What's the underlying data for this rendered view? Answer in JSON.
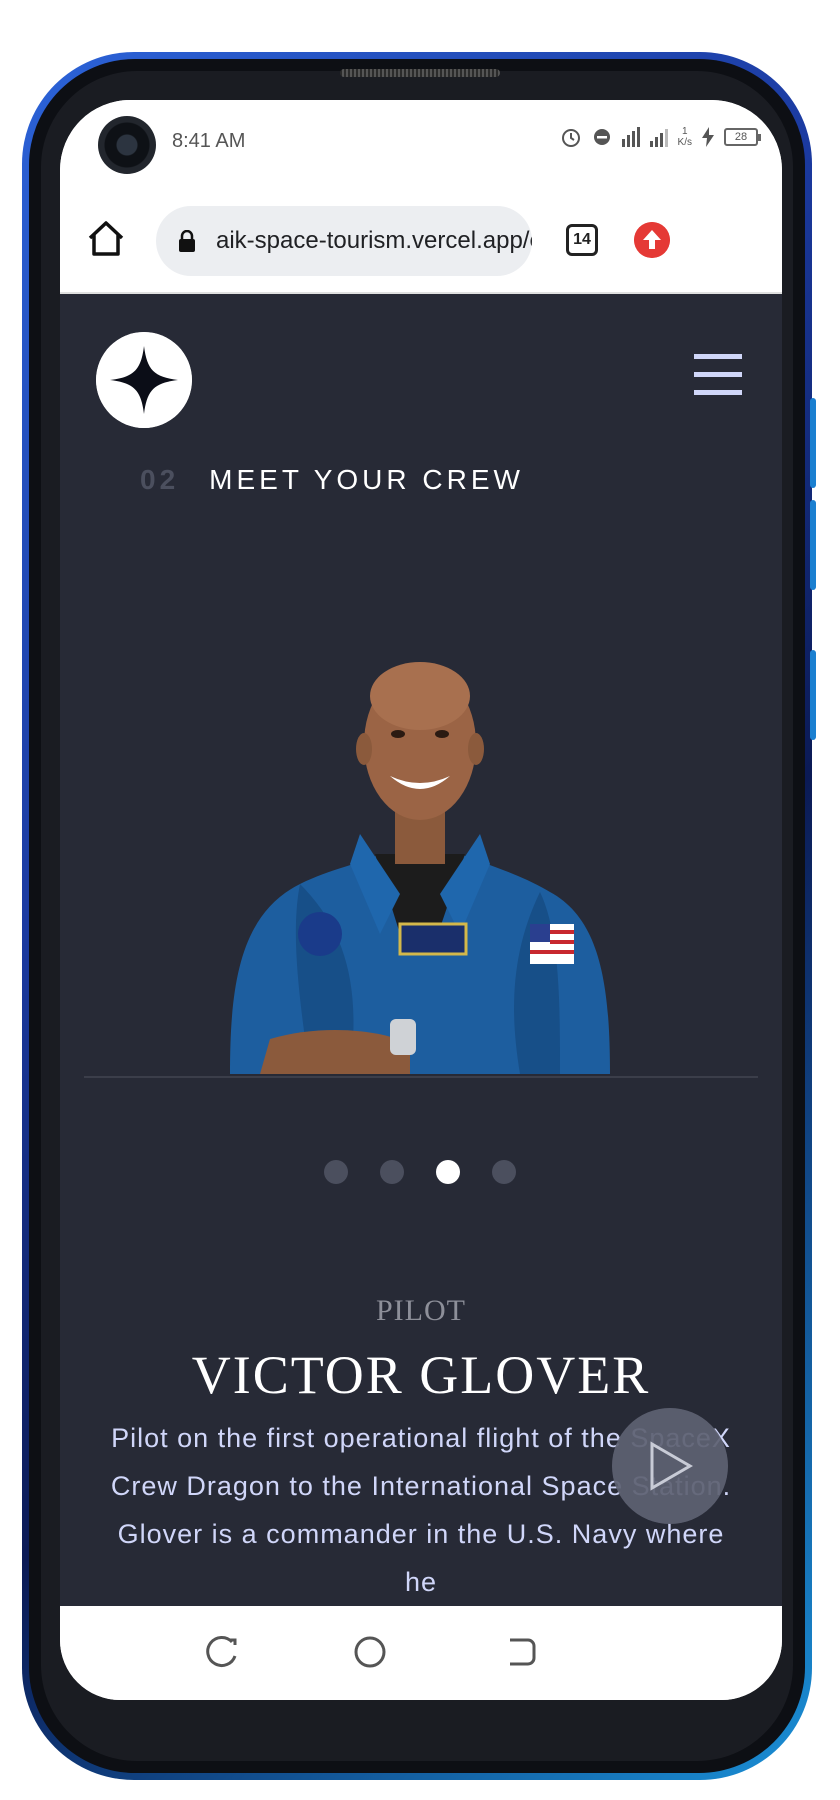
{
  "status_bar": {
    "time": "8:41 AM",
    "network_speed_value": "1",
    "network_speed_unit": "K/s",
    "battery": "28"
  },
  "browser": {
    "url": "aik-space-tourism.vercel.app/crew",
    "tab_count": "14"
  },
  "page": {
    "heading_number": "02",
    "heading_text": "MEET YOUR CREW",
    "carousel_active_index": 2,
    "carousel_count": 4,
    "crew": {
      "role": "PILOT",
      "name": "VICTOR GLOVER",
      "bio_lines": [
        "Pilot on the first operational flight of the SpaceX",
        "Crew Dragon to the International Space Station.",
        "Glover is a commander in the U.S. Navy where he"
      ]
    }
  },
  "colors": {
    "page_bg": "#272a36",
    "accent_text": "#d0d6f9",
    "update_icon": "#e53935",
    "phone_frame": "#1b3aa0"
  },
  "icons": [
    "home-icon",
    "lock-icon",
    "tabs-icon",
    "update-icon",
    "hamburger-menu-icon",
    "star-logo-icon",
    "play-icon",
    "recent-apps-icon",
    "home-nav-icon",
    "back-icon",
    "alarm-icon",
    "dnd-icon",
    "signal-icon",
    "battery-icon"
  ]
}
